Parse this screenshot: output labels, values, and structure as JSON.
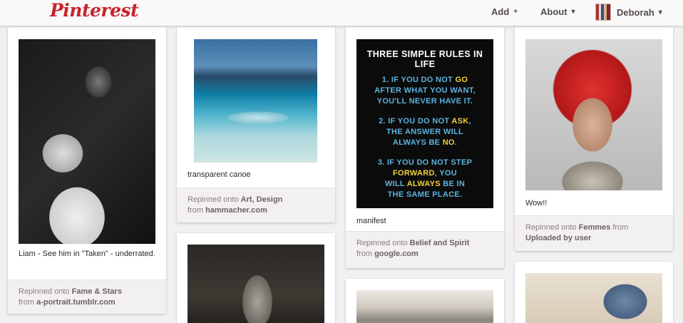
{
  "header": {
    "logo": "Pinterest",
    "nav": [
      {
        "label": "Add",
        "glyph": "+"
      },
      {
        "label": "About",
        "glyph": "▾"
      }
    ],
    "user": {
      "name": "Deborah",
      "glyph": "▾"
    }
  },
  "pins": {
    "liam": {
      "desc": "Liam - See him in \"Taken\" - underrated.",
      "repinned_prefix": "Repinned onto",
      "board": "Fame & Stars",
      "from_prefix": "from",
      "source": "a-portrait.tumblr.com"
    },
    "canoe": {
      "desc": "transparent canoe",
      "repinned_prefix": "Repinned onto",
      "board": "Art, Design",
      "from_prefix": "from",
      "source": "hammacher.com"
    },
    "rules": {
      "title": "THREE SIMPLE RULES IN LIFE",
      "rule1": {
        "a": "1. IF YOU DO NOT ",
        "b": "GO",
        "c": "AFTER WHAT YOU WANT,",
        "d": "YOU'LL NEVER HAVE IT."
      },
      "rule2": {
        "a": "2. IF YOU DO NOT ",
        "b": "ASK",
        "c": ",",
        "d": "THE ANSWER WILL",
        "e": "ALWAYS BE ",
        "f": "NO",
        "g": "."
      },
      "rule3": {
        "a": "3. IF YOU DO NOT STEP",
        "b": "FORWARD",
        "c": ", YOU",
        "d": "WILL ",
        "e": "ALWAYS",
        "f": " BE IN",
        "g": "THE SAME PLACE."
      },
      "desc": "manifest",
      "repinned_prefix": "Repinned onto",
      "board": "Belief and Spirit",
      "from_prefix": "from",
      "source": "google.com"
    },
    "hair": {
      "desc": "Wow!!",
      "repinned_prefix": "Repinned onto",
      "board": "Femmes",
      "from_prefix": "from",
      "source": "Uploaded by user"
    }
  },
  "colors": {
    "brand": "#c8232c",
    "rule_blue": "#5cb3e0",
    "rule_yellow": "#f2d23c"
  }
}
